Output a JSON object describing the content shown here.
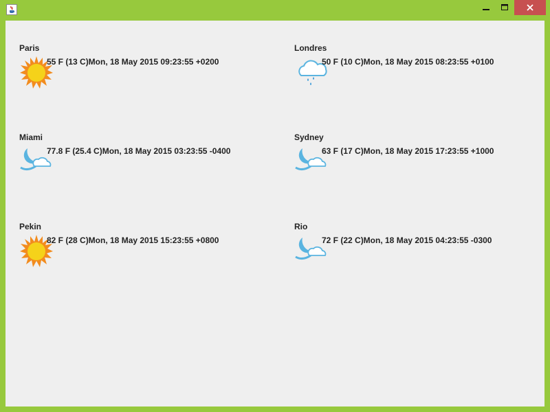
{
  "window": {
    "controls": {
      "minimize": "minimize",
      "maximize": "maximize",
      "close": "close"
    }
  },
  "cities": [
    {
      "name": "Paris",
      "info": "55 F (13 C)Mon, 18 May 2015 09:23:55 +0200",
      "icon": "sun-icon"
    },
    {
      "name": "Londres",
      "info": "50 F (10 C)Mon, 18 May 2015 08:23:55 +0100",
      "icon": "rain-cloud-icon"
    },
    {
      "name": "Miami",
      "info": "77.8 F (25.4 C)Mon, 18 May 2015 03:23:55 -0400",
      "icon": "moon-cloud-icon"
    },
    {
      "name": "Sydney",
      "info": "63 F (17 C)Mon, 18 May 2015 17:23:55 +1000",
      "icon": "moon-cloud-icon"
    },
    {
      "name": "Pekin",
      "info": "82 F (28 C)Mon, 18 May 2015 15:23:55 +0800",
      "icon": "sun-icon"
    },
    {
      "name": "Rio",
      "info": "72 F (22 C)Mon, 18 May 2015 04:23:55 -0300",
      "icon": "moon-cloud-icon"
    }
  ],
  "colors": {
    "frame": "#97c93d",
    "close_button": "#c75050",
    "content_bg": "#efefef",
    "sun": "#f5d21a",
    "sun_rays": "#f28c1e",
    "cloud_outline": "#5ab4e0",
    "rain": "#3a9ad9"
  }
}
